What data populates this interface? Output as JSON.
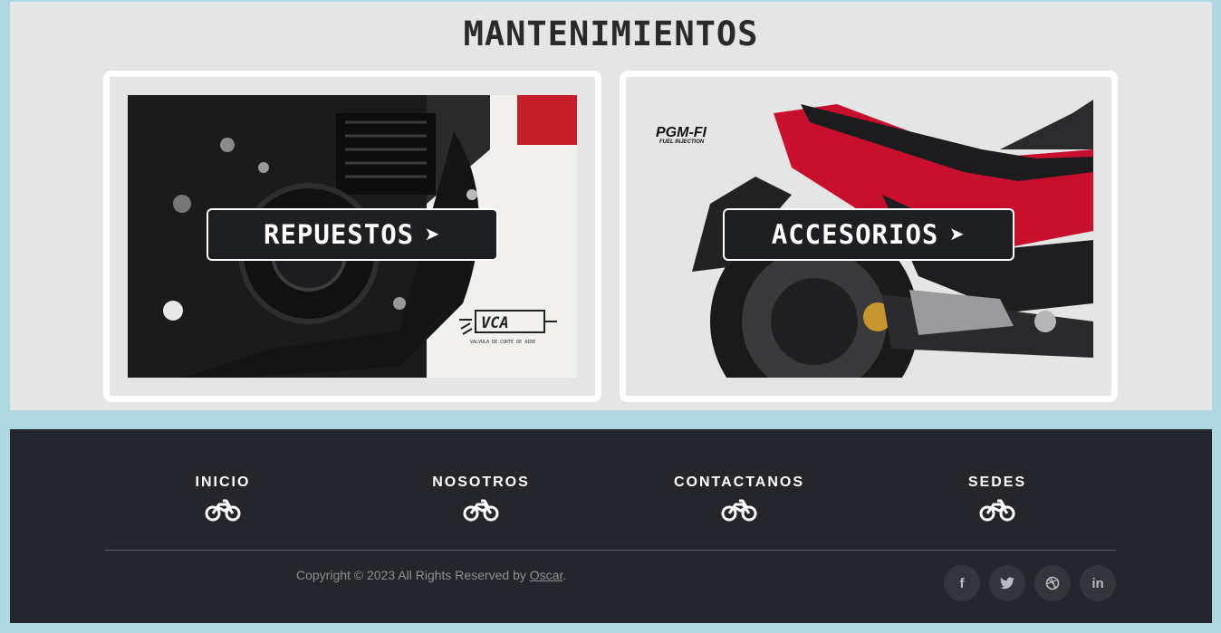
{
  "section": {
    "title": "MANTENIMIENTOS"
  },
  "cards": [
    {
      "label": "REPUESTOS",
      "arrow": "➤",
      "image_text": "VCA",
      "image_subtext": "VALVULA DE CORTE DE AIRE"
    },
    {
      "label": "ACCESORIOS",
      "arrow": "➤",
      "image_text": "PGM-FI",
      "image_subtext": "FUEL INJECTION"
    }
  ],
  "footer": {
    "nav": [
      {
        "label": "INICIO",
        "icon": "motorcycle-icon"
      },
      {
        "label": "NOSOTROS",
        "icon": "motorcycle-icon"
      },
      {
        "label": "CONTACTANOS",
        "icon": "motorcycle-icon"
      },
      {
        "label": "SEDES",
        "icon": "motorcycle-icon"
      }
    ],
    "copyright_prefix": "Copyright © 2023 All Rights Reserved by ",
    "copyright_author": "Oscar",
    "copyright_suffix": ".",
    "social": [
      {
        "glyph": "f",
        "icon": "facebook-icon"
      },
      {
        "glyph": "🐦",
        "icon": "twitter-icon"
      },
      {
        "glyph": "◎",
        "icon": "dribbble-icon"
      },
      {
        "glyph": "in",
        "icon": "linkedin-icon"
      }
    ]
  },
  "colors": {
    "page_border": "#add8e2",
    "section_bg": "#e5e5e5",
    "footer_bg": "#24262b",
    "button_bg": "#1e1f22",
    "accent_red": "#c8102e"
  }
}
